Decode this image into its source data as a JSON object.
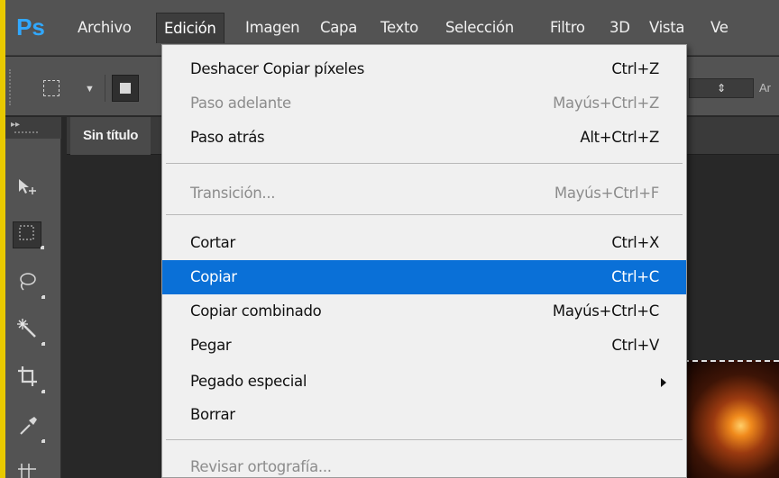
{
  "app": {
    "logo": "Ps",
    "menus": [
      "Archivo",
      "Edición",
      "Imagen",
      "Capa",
      "Texto",
      "Selección",
      "Filtro",
      "3D",
      "Vista",
      "Ve"
    ],
    "active_menu": "Edición"
  },
  "options_bar": {
    "tool_icon": "rect-marquee-icon",
    "style_value": "",
    "truncated_label": "Ar"
  },
  "document": {
    "tab_title": "Sin título"
  },
  "tools": [
    {
      "name": "move-tool-icon"
    },
    {
      "name": "rect-marquee-tool-icon",
      "selected": true
    },
    {
      "name": "lasso-tool-icon"
    },
    {
      "name": "magic-wand-tool-icon"
    },
    {
      "name": "crop-tool-icon"
    },
    {
      "name": "eyedropper-tool-icon"
    },
    {
      "name": "frame-tool-icon"
    }
  ],
  "edit_menu": {
    "items": [
      {
        "label": "Deshacer Copiar píxeles",
        "shortcut": "Ctrl+Z",
        "disabled": false
      },
      {
        "label": "Paso adelante",
        "shortcut": "Mayús+Ctrl+Z",
        "disabled": true
      },
      {
        "label": "Paso atrás",
        "shortcut": "Alt+Ctrl+Z",
        "disabled": false
      },
      {
        "label": "Transición...",
        "shortcut": "Mayús+Ctrl+F",
        "disabled": true
      },
      {
        "label": "Cortar",
        "shortcut": "Ctrl+X",
        "disabled": false
      },
      {
        "label": "Copiar",
        "shortcut": "Ctrl+C",
        "disabled": false,
        "highlighted": true
      },
      {
        "label": "Copiar combinado",
        "shortcut": "Mayús+Ctrl+C",
        "disabled": false
      },
      {
        "label": "Pegar",
        "shortcut": "Ctrl+V",
        "disabled": false
      },
      {
        "label": "Pegado especial",
        "shortcut": "",
        "submenu": true,
        "disabled": false
      },
      {
        "label": "Borrar",
        "shortcut": "",
        "disabled": false
      },
      {
        "label": "Revisar ortografía...",
        "shortcut": "",
        "disabled": true
      }
    ]
  },
  "colors": {
    "highlight": "#0a70d7",
    "menu_bg": "#f0f0f0",
    "chrome": "#535353",
    "frame": "#e8c900"
  }
}
